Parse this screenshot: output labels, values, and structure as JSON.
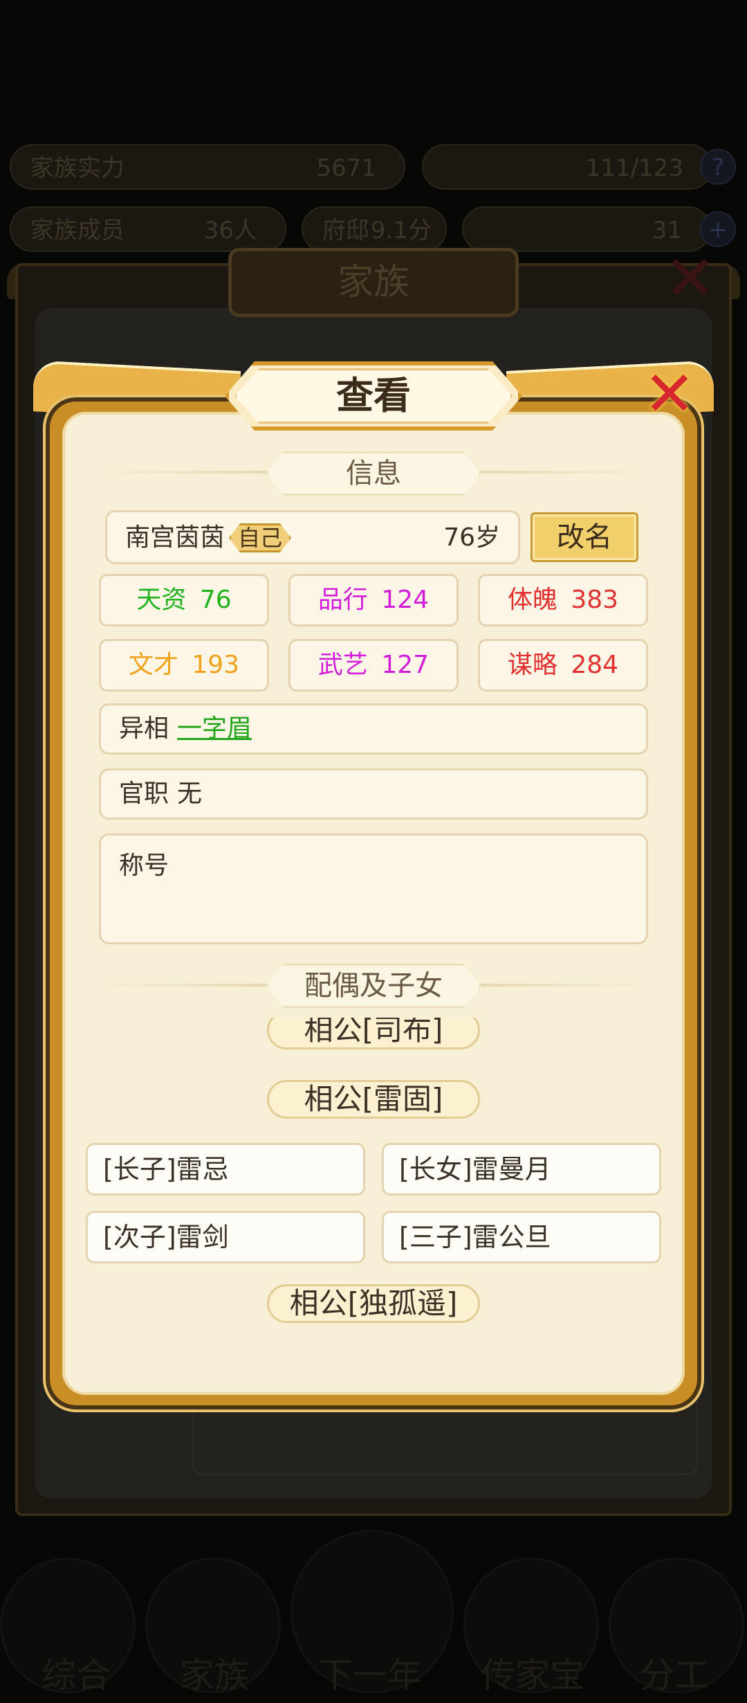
{
  "background": {
    "top_stats": [
      {
        "label": "家族实力",
        "value": "5671"
      },
      {
        "label": "",
        "value": "111/123"
      }
    ],
    "second_stats": [
      {
        "label": "家族成员",
        "value": "36人"
      },
      {
        "label": "府邸",
        "value": "9.1分"
      },
      {
        "label": "",
        "value": "31"
      }
    ],
    "panel_title": "家族",
    "nav": [
      "综合",
      "家族",
      "下一年",
      "传家宝",
      "分工"
    ]
  },
  "dialog": {
    "title": "查看",
    "close_icon": "close-x-icon",
    "info_header": "信息",
    "name": "南宫茵茵",
    "self_tag": "自己",
    "age": "76岁",
    "rename_label": "改名",
    "stats": [
      {
        "label": "天资",
        "value": "76",
        "color": "#22b21e"
      },
      {
        "label": "品行",
        "value": "124",
        "color": "#d21ed8"
      },
      {
        "label": "体魄",
        "value": "383",
        "color": "#e23030"
      },
      {
        "label": "文才",
        "value": "193",
        "color": "#f0a21a"
      },
      {
        "label": "武艺",
        "value": "127",
        "color": "#d21ed8"
      },
      {
        "label": "谋略",
        "value": "284",
        "color": "#e23030"
      }
    ],
    "trait_label": "异相",
    "trait_value": "一字眉",
    "office_label": "官职",
    "office_value": "无",
    "title_label": "称号",
    "family_header": "配偶及子女",
    "spouses": [
      {
        "label": "相公[司布]",
        "children": []
      },
      {
        "label": "相公[雷固]",
        "children": [
          "[长子]雷忌",
          "[长女]雷曼月",
          "[次子]雷剑",
          "[三子]雷公旦"
        ]
      },
      {
        "label": "相公[独孤遥]",
        "children": []
      }
    ]
  }
}
